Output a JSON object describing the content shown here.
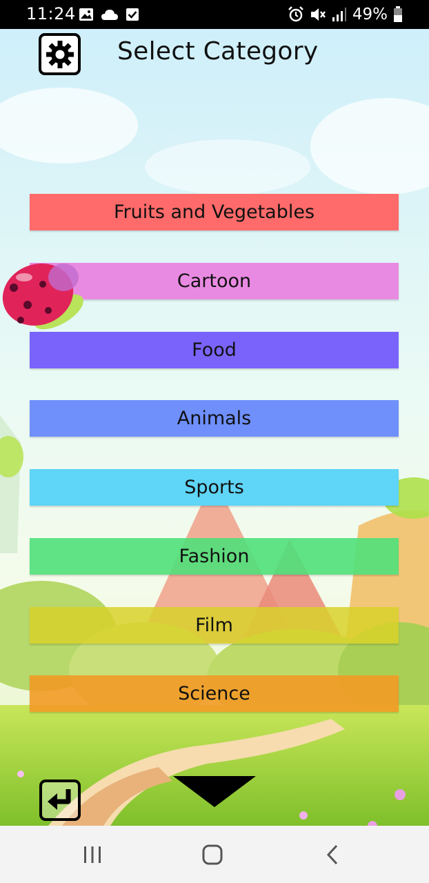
{
  "status_bar": {
    "time": "11:24",
    "battery_percent": "49%",
    "left_icons": [
      "image-icon",
      "cloud-icon",
      "check-box-icon"
    ],
    "right_icons": [
      "alarm-icon",
      "mute-icon",
      "signal-icon",
      "battery-icon"
    ]
  },
  "header": {
    "title": "Select Category",
    "settings_icon": "gear-icon"
  },
  "categories": [
    {
      "label": "Fruits and Vegetables",
      "color": "#ff6a6a"
    },
    {
      "label": "Cartoon",
      "color": "#e98ae2"
    },
    {
      "label": "Food",
      "color": "#7a63fb"
    },
    {
      "label": "Animals",
      "color": "#6f8ffb"
    },
    {
      "label": "Sports",
      "color": "#5fd5f7"
    },
    {
      "label": "Fashion",
      "color": "#4fe07a"
    },
    {
      "label": "Film",
      "color": "#d8d12a"
    },
    {
      "label": "Science",
      "color": "#f29a26"
    }
  ],
  "footer": {
    "back_icon": "return-arrow-icon",
    "more_icon": "down-triangle-icon"
  },
  "nav_bar": {
    "buttons": [
      "recent-apps-icon",
      "home-icon",
      "back-icon"
    ]
  }
}
